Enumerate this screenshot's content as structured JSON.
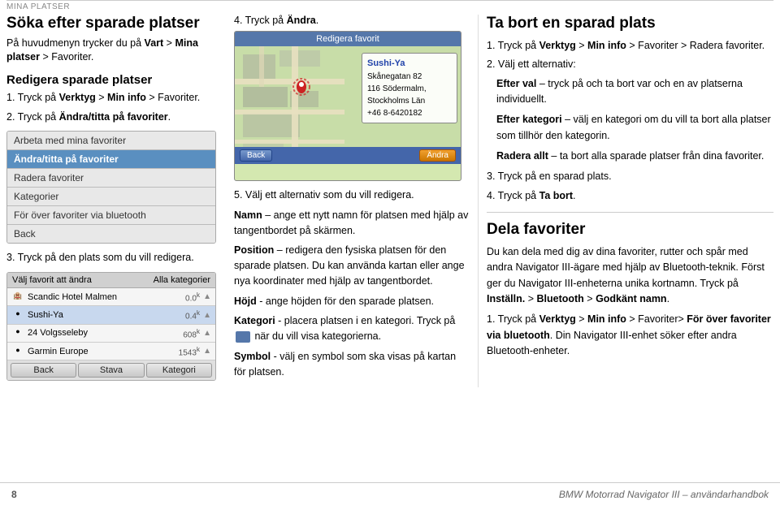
{
  "header": {
    "breadcrumb": "Mina platser"
  },
  "left": {
    "section1_title": "Söka efter sparade platser",
    "section1_body": "På huvudmenyn trycker du på Vart > Mina platser > Favoriter.",
    "section1_body_bold1": "Vart",
    "section1_body_bold2": "Mina platser",
    "section2_title": "Redigera sparade platser",
    "step1": "1. Tryck på ",
    "step1_bold": "Verktyg",
    "step1_mid": " > ",
    "step1_bold2": "Min info",
    "step1_end": " > Favoriter.",
    "step2": "2. Tryck på ",
    "step2_bold": "Ändra/titta på favoriter",
    "step2_end": ".",
    "menu_items": [
      {
        "label": "Arbeta med mina favoriter",
        "highlighted": false
      },
      {
        "label": "Ändra/titta på favoriter",
        "highlighted": true
      },
      {
        "label": "Radera favoriter",
        "highlighted": false
      },
      {
        "label": "Kategorier",
        "highlighted": false
      },
      {
        "label": "För över favoriter via bluetooth",
        "highlighted": false
      },
      {
        "label": "Back",
        "highlighted": false
      }
    ],
    "step3": "3. Tryck på den plats som du vill redigera.",
    "fav_header_left": "Välj favorit att ändra",
    "fav_header_right": "Alla kategorier",
    "fav_rows": [
      {
        "name": "Scandic Hotel Malmen",
        "dist": "0.0",
        "unit": "k",
        "icon": "🏨",
        "highlighted": false
      },
      {
        "name": "Sushi-Ya",
        "dist": "0.4",
        "unit": "k",
        "icon": "🍣",
        "highlighted": true
      },
      {
        "name": "24 Volgsseleby",
        "dist": "608",
        "unit": "k",
        "icon": "📍",
        "highlighted": false
      },
      {
        "name": "Garmin Europe",
        "dist": "1543",
        "unit": "k",
        "icon": "📍",
        "highlighted": false
      }
    ],
    "fav_btns": [
      "Back",
      "Stava",
      "Kategori"
    ]
  },
  "mid": {
    "step4_pre": "4. Tryck på ",
    "step4_bold": "Ändra",
    "step4_end": ".",
    "map_header": "Redigera favorit",
    "map_place_name": "Sushi-Ya",
    "map_address1": "Skånegatan 82",
    "map_address2": "116 Södermalm,",
    "map_address3": "Stockholms Län",
    "map_address4": "+46 8-6420182",
    "map_btn_back": "Back",
    "map_btn_andra": "Ändra",
    "step5_pre": "5. Välj ett alternativ som du vill redigera.",
    "term_namn": "Namn",
    "desc_namn": " – ange ett nytt namn för platsen med hjälp av tangentbordet på skärmen.",
    "term_position": "Position",
    "desc_position": " – redigera den fysiska platsen för den sparade platsen. Du kan använda kartan eller ange nya koordinater med hjälp av tangentbordet.",
    "term_hojd": "Höjd",
    "desc_hojd": " - ange höjden för den sparade platsen.",
    "term_kategori": "Kategori",
    "desc_kategori": " - placera platsen i en kategori. Tryck på ",
    "desc_kategori2": " när du vill visa kategorierna.",
    "term_symbol": "Symbol",
    "desc_symbol": " - välj en symbol som ska visas på kartan för platsen."
  },
  "right": {
    "section_title": "Ta bort en sparad plats",
    "step1_pre": "1. Tryck på ",
    "step1_bold1": "Verktyg",
    "step1_mid": " > ",
    "step1_bold2": "Min info",
    "step1_end": " > Favoriter > Radera favoriter.",
    "step2_label": "2. Välj ett alternativ:",
    "alt1_bold": "Efter val",
    "alt1_desc": " – tryck på och ta bort var och en av platserna individuellt.",
    "alt2_bold": "Efter kategori",
    "alt2_desc": " – välj en kategori om du vill ta bort alla platser som tillhör den kategorin.",
    "alt3_bold": "Radera allt",
    "alt3_desc": " – ta bort alla sparade platser från dina favoriter.",
    "step3": "3. Tryck på en sparad plats.",
    "step4_pre": "4. Tryck på ",
    "step4_bold": "Ta bort",
    "step4_end": ".",
    "section2_title": "Dela favoriter",
    "section2_body1": "Du kan dela med dig av dina favoriter, rutter och spår med andra Navigator III-ägare med hjälp av Bluetooth-teknik. Först ger du Navigator III-enheterna unika kortnamn. Tryck på ",
    "section2_body1_bold1": "Inställn.",
    "section2_body1_mid": " > ",
    "section2_body1_bold2": "Bluetooth",
    "section2_body1_mid2": " > ",
    "section2_body1_bold3": "Godkänt namn",
    "section2_body1_end": ".",
    "del_step1_pre": "1. Tryck på ",
    "del_step1_bold1": "Verktyg",
    "del_step1_mid": " > ",
    "del_step1_bold2": "Min info",
    "del_step1_end": " > Favoriter> För över favoriter via bluetooth",
    "del_step1_end2": ". Din Navigator III-enhet söker efter andra Bluetooth-enheter."
  },
  "footer": {
    "page_num": "8",
    "title": "BMW Motorrad Navigator III – användarhandbok"
  }
}
